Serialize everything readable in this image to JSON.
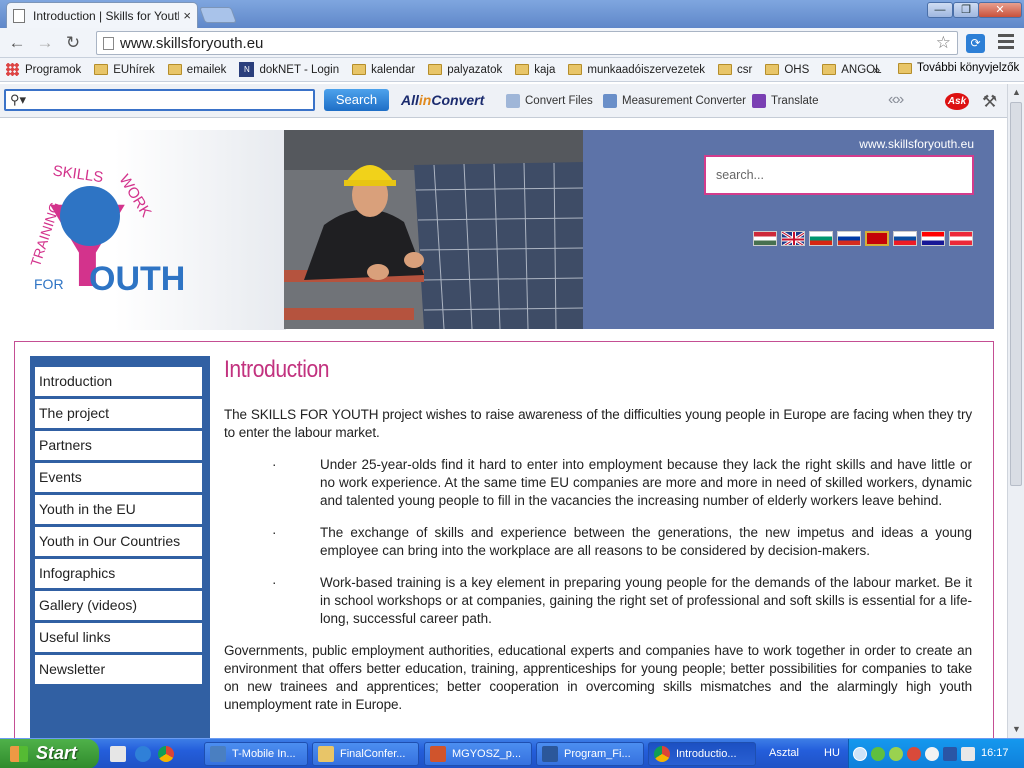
{
  "browser": {
    "tab_title": "Introduction | Skills for Youth",
    "tab_close": "×",
    "url": "www.skillsforyouth.eu",
    "window_controls": {
      "minimize": "—",
      "maximize": "❐",
      "close": "✕"
    }
  },
  "bookmarks": {
    "items": [
      "Programok",
      "EUhírek",
      "emailek",
      "dokNET - Login",
      "kalendar",
      "palyazatok",
      "kaja",
      "munkaadóiszervezetek",
      "csr",
      "OHS",
      "ANGOL"
    ],
    "more": "»",
    "other": "További könyvjelzők"
  },
  "ask_toolbar": {
    "search_button": "Search",
    "allin_prefix": "All",
    "allin_mid": "in",
    "allin_suffix": "Convert",
    "items": [
      "Convert Files",
      "Measurement Converter",
      "Translate"
    ],
    "ask_logo": "Ask"
  },
  "site": {
    "url_label": "www.skillsforyouth.eu",
    "search_placeholder": "search...",
    "logo": {
      "skills": "SKILLS",
      "work": "WORK",
      "training": "TRAINING",
      "for": "FOR",
      "youth": "OUTH",
      "y": "Y"
    },
    "flags": [
      "hungary",
      "uk",
      "bulgaria",
      "slovenia",
      "montenegro",
      "slovakia",
      "croatia",
      "austria"
    ]
  },
  "nav": {
    "items": [
      "Introduction",
      "The project",
      "Partners",
      "Events",
      "Youth in the EU",
      "Youth in Our Countries",
      "Infographics",
      "Gallery (videos)",
      "Useful links",
      "Newsletter"
    ]
  },
  "content": {
    "title": "Introduction",
    "intro": "The SKILLS FOR YOUTH project wishes to raise awareness of the difficulties young people in Europe are facing when they try to enter the labour market.",
    "bullet_mark": "·",
    "bullets": [
      "Under 25-year-olds find it hard to enter into employment because they lack the right skills and have little or no work experience. At the same time EU companies are more and more in need of skilled workers, dynamic and talented young people to fill in the vacancies the increasing number of elderly workers leave behind.",
      "The exchange of skills and experience between the generations, the new impetus and ideas a young employee can bring into the workplace are all reasons to be considered by decision-makers.",
      "Work-based training  is a key element in preparing young people for the demands of the labour market. Be it in school workshops or at companies, gaining the right set of professional and soft skills is essential for a life-long, successful career path."
    ],
    "closing": "Governments, public employment authorities, educational experts and companies have to work together in order to create an environment that offers better education, training, apprenticeships for young people; better possibilities for companies to take on new trainees and apprentices; better cooperation in overcoming skills mismatches and the alarmingly high youth unemployment rate in Europe."
  },
  "taskbar": {
    "start": "Start",
    "tasks": [
      "T-Mobile In...",
      "FinalConfer...",
      "MGYOSZ_p...",
      "Program_Fi...",
      "Introductio..."
    ],
    "desktop": "Asztal",
    "lang": "HU",
    "clock": "16:17"
  },
  "colors": {
    "accent_pink": "#c2327f",
    "nav_blue": "#3160a3",
    "header_blue": "#5d73a8",
    "logo_blue": "#2e74c4"
  }
}
